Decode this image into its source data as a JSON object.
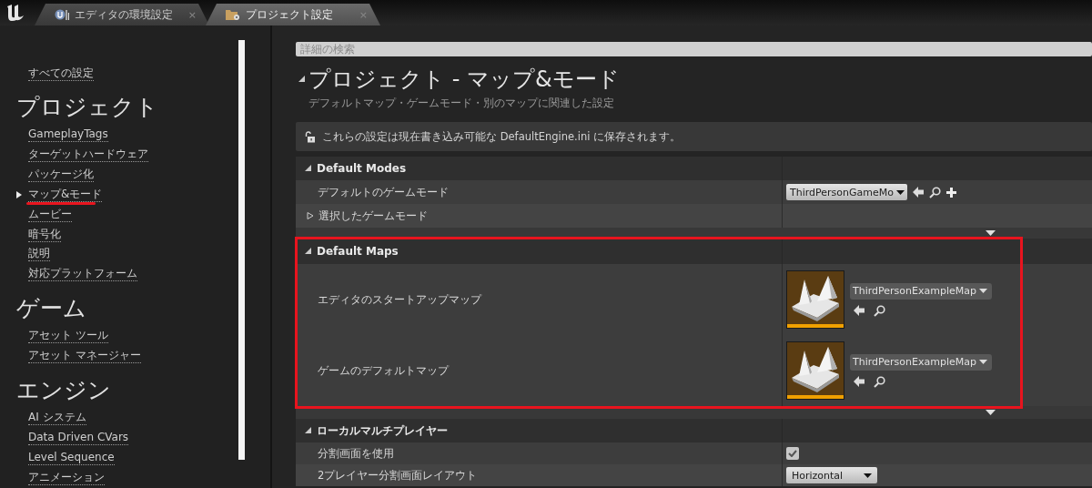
{
  "tabs": [
    {
      "label": "エディタの環境設定",
      "selected": false,
      "close": "×"
    },
    {
      "label": "プロジェクト設定",
      "selected": true,
      "close": "×"
    }
  ],
  "sidebar": {
    "all_settings": "すべての設定",
    "categories": [
      {
        "title": "プロジェクト",
        "items": [
          {
            "label": "GameplayTags",
            "selected": false,
            "highlighted": false
          },
          {
            "label": "ターゲットハードウェア",
            "selected": false,
            "highlighted": false
          },
          {
            "label": "パッケージ化",
            "selected": false,
            "highlighted": false
          },
          {
            "label": "マップ&モード",
            "selected": true,
            "highlighted": true
          },
          {
            "label": "ムービー",
            "selected": false,
            "highlighted": false
          },
          {
            "label": "暗号化",
            "selected": false,
            "highlighted": false
          },
          {
            "label": "説明",
            "selected": false,
            "highlighted": false
          },
          {
            "label": "対応プラットフォーム",
            "selected": false,
            "highlighted": false
          }
        ]
      },
      {
        "title": "ゲーム",
        "items": [
          {
            "label": "アセット ツール",
            "selected": false,
            "highlighted": false
          },
          {
            "label": "アセット マネージャー",
            "selected": false,
            "highlighted": false
          }
        ]
      },
      {
        "title": "エンジン",
        "items": [
          {
            "label": "AI システム",
            "selected": false,
            "highlighted": false
          },
          {
            "label": "Data Driven CVars",
            "selected": false,
            "highlighted": false
          },
          {
            "label": "Level Sequence",
            "selected": false,
            "highlighted": false
          },
          {
            "label": "アニメーション",
            "selected": false,
            "highlighted": false
          }
        ]
      }
    ]
  },
  "search": {
    "placeholder": "詳細の検索"
  },
  "page": {
    "title": "プロジェクト - マップ&モード",
    "expanded": true,
    "subtitle": "デフォルトマップ・ゲームモード・別のマップに関連した設定",
    "notice": "これらの設定は現在書き込み可能な DefaultEngine.ini に保存されます。"
  },
  "sections": [
    {
      "title": "Default Modes",
      "expanded": true,
      "highlighted": false,
      "rows": [
        {
          "kind": "class",
          "label": "デフォルトのゲームモード",
          "value": "ThirdPersonGameMo"
        },
        {
          "kind": "group",
          "label": "選択したゲームモード",
          "expanded": false
        }
      ]
    },
    {
      "title": "Default Maps",
      "expanded": true,
      "highlighted": true,
      "rows": [
        {
          "kind": "map",
          "label": "エディタのスタートアップマップ",
          "value": "ThirdPersonExampleMap"
        },
        {
          "kind": "map",
          "label": "ゲームのデフォルトマップ",
          "value": "ThirdPersonExampleMap"
        }
      ]
    },
    {
      "title": "ローカルマルチプレイヤー",
      "expanded": true,
      "highlighted": false,
      "rows": [
        {
          "kind": "checkbox",
          "label": "分割画面を使用",
          "checked": true
        },
        {
          "kind": "combo",
          "label": "2プレイヤー分割画面レイアウト",
          "value": "Horizontal"
        }
      ]
    }
  ]
}
